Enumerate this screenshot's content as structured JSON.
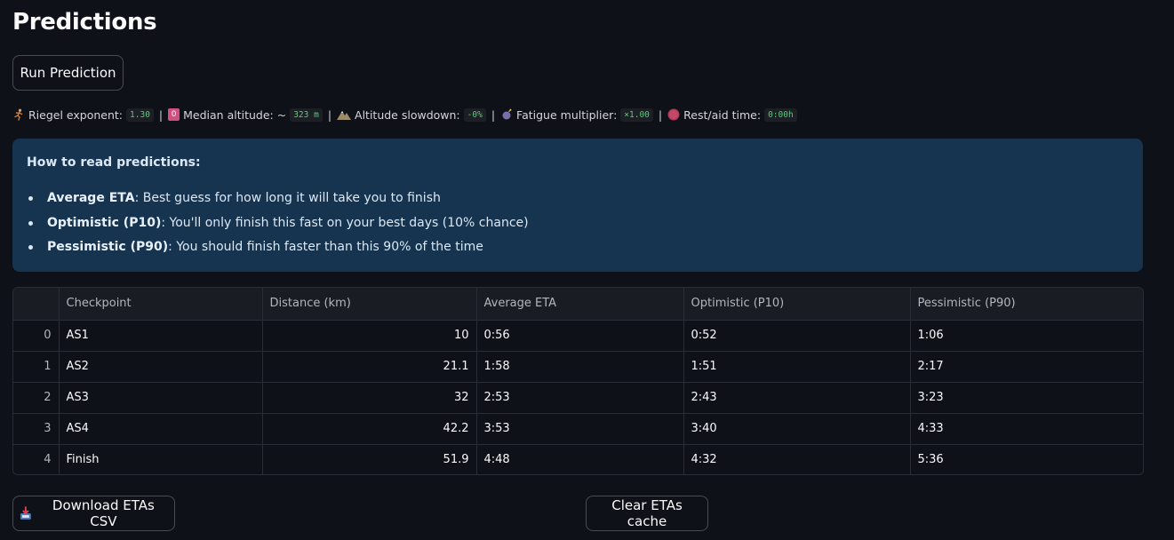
{
  "page": {
    "title": "Predictions",
    "run_button": "Run Prediction"
  },
  "params": {
    "riegel_label": "Riegel exponent:",
    "riegel_value": "1.30",
    "median_alt_icon_text": "0",
    "median_alt_label": "Median altitude: ~",
    "median_alt_value": "323 m",
    "alt_slowdown_label": "Altitude slowdown:",
    "alt_slowdown_value": "-0%",
    "fatigue_label": "Fatigue multiplier:",
    "fatigue_value": "×1.00",
    "rest_label": "Rest/aid time:",
    "rest_value": "0:00h",
    "separator": "|"
  },
  "info": {
    "title": "How to read predictions:",
    "items": [
      {
        "term": "Average ETA",
        "desc": ": Best guess for how long it will take you to finish"
      },
      {
        "term": "Optimistic (P10)",
        "desc": ": You'll only finish this fast on your best days (10% chance)"
      },
      {
        "term": "Pessimistic (P90)",
        "desc": ": You should finish faster than this 90% of the time"
      }
    ]
  },
  "table": {
    "headers": [
      "",
      "Checkpoint",
      "Distance (km)",
      "Average ETA",
      "Optimistic (P10)",
      "Pessimistic (P90)"
    ],
    "rows": [
      [
        "0",
        "AS1",
        "10",
        "0:56",
        "0:52",
        "1:06"
      ],
      [
        "1",
        "AS2",
        "21.1",
        "1:58",
        "1:51",
        "2:17"
      ],
      [
        "2",
        "AS3",
        "32",
        "2:53",
        "2:43",
        "3:23"
      ],
      [
        "3",
        "AS4",
        "42.2",
        "3:53",
        "3:40",
        "4:33"
      ],
      [
        "4",
        "Finish",
        "51.9",
        "4:48",
        "4:32",
        "5:36"
      ]
    ]
  },
  "actions": {
    "download_label": "Download ETAs CSV",
    "clear_label": "Clear ETAs cache"
  },
  "icons": {
    "runner": "runner-icon",
    "zero": "keycap-zero-icon",
    "mountain": "mountain-icon",
    "fatigue": "bomb-icon",
    "rest": "stop-circle-icon",
    "download": "inbox-tray-icon"
  },
  "colors": {
    "background": "#0e1117",
    "info_bg": "#163450",
    "code_green": "#5ec97c",
    "zero_badge": "#d05180"
  }
}
